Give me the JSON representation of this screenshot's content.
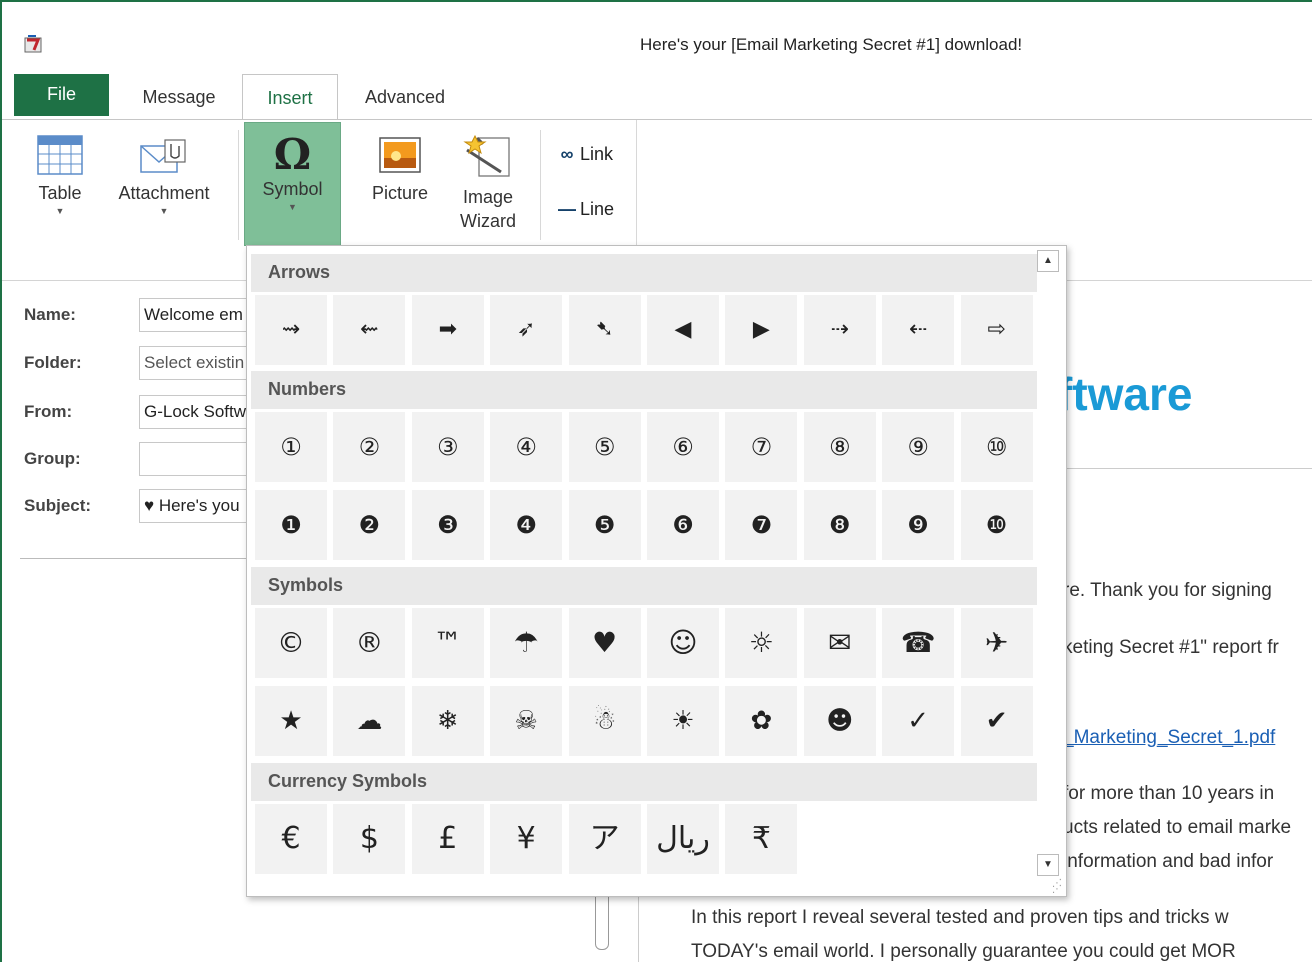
{
  "window": {
    "title": "Here's your [Email Marketing Secret #1] download!"
  },
  "tabs": {
    "file": "File",
    "message": "Message",
    "insert": "Insert",
    "advanced": "Advanced"
  },
  "ribbon": {
    "table": "Table",
    "attachment": "Attachment",
    "symbol": "Symbol",
    "symbol_glyph": "Ω",
    "picture": "Picture",
    "image_wizard_1": "Image",
    "image_wizard_2": "Wizard",
    "link": "Link",
    "line": "Line"
  },
  "form": {
    "name_label": "Name:",
    "name_value": "Welcome em",
    "folder_label": "Folder:",
    "folder_placeholder": "Select existin",
    "from_label": "From:",
    "from_value": "G-Lock Softw",
    "group_label": "Group:",
    "group_value": "",
    "subject_label": "Subject:",
    "subject_value": "♥ Here's you"
  },
  "preview": {
    "brand": "ftware",
    "line1": "re. Thank you for signing",
    "line2": "keting Secret #1\" report fr",
    "link": "_Marketing_Secret_1.pdf",
    "line4": "for more than 10 years in",
    "line5": "ucts related to email marke",
    "line6": "information and bad infor",
    "line7": "In this report I reveal several tested and proven tips and tricks w",
    "line8": "TODAY's email world. I personally guarantee you could get MOR"
  },
  "symbols": {
    "arrows_title": "Arrows",
    "arrows": [
      "⇝",
      "⇜",
      "➡",
      "➶",
      "➷",
      "◀",
      "▶",
      "⇢",
      "⇠",
      "⇨"
    ],
    "numbers_title": "Numbers",
    "numbers_outline": [
      "①",
      "②",
      "③",
      "④",
      "⑤",
      "⑥",
      "⑦",
      "⑧",
      "⑨",
      "⑩"
    ],
    "numbers_filled": [
      "❶",
      "❷",
      "❸",
      "❹",
      "❺",
      "❻",
      "❼",
      "❽",
      "❾",
      "❿"
    ],
    "symbols_title": "Symbols",
    "symbols_row1": [
      "©",
      "®",
      "™",
      "☂",
      "♥",
      "☺",
      "☼",
      "✉",
      "☎",
      "✈"
    ],
    "symbols_row2": [
      "★",
      "☁",
      "❄",
      "☠",
      "☃",
      "☀",
      "✿",
      "☻",
      "✓",
      "✔"
    ],
    "currency_title": "Currency Symbols",
    "currency": [
      "€",
      "$",
      "£",
      "¥",
      "ア",
      "ريال",
      "₹"
    ]
  },
  "scroll": {
    "up": "▲",
    "down": "▼"
  }
}
